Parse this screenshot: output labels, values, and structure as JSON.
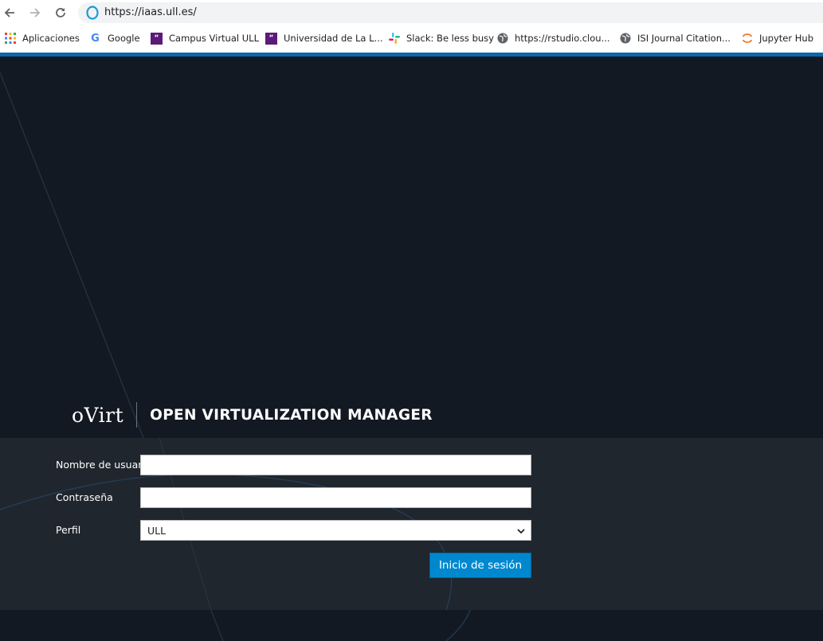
{
  "browser": {
    "url": "https://iaas.ull.es/",
    "bookmarks": [
      {
        "label": "Aplicaciones",
        "icon": "apps-grid-icon"
      },
      {
        "label": "Google",
        "icon": "google-icon"
      },
      {
        "label": "Campus Virtual ULL",
        "icon": "moodle-icon"
      },
      {
        "label": "Universidad de La L...",
        "icon": "moodle-icon"
      },
      {
        "label": "Slack: Be less busy",
        "icon": "slack-icon"
      },
      {
        "label": "https://rstudio.clou...",
        "icon": "globe-icon"
      },
      {
        "label": "ISI Journal Citation...",
        "icon": "globe-icon"
      },
      {
        "label": "Jupyter Hub",
        "icon": "jupyter-icon"
      }
    ],
    "accent_color": "#0a67ab"
  },
  "brand": {
    "logo": "oVirt",
    "product": "OPEN VIRTUALIZATION MANAGER"
  },
  "login_form": {
    "username_label": "Nombre de usuar",
    "username_value": "",
    "password_label": "Contraseña",
    "password_value": "",
    "profile_label": "Perfil",
    "profile_selected": "ULL",
    "submit_label": "Inicio de sesión"
  },
  "colors": {
    "page_background": "#131923",
    "form_panel": "#1f262e",
    "button": "#0088ce"
  }
}
